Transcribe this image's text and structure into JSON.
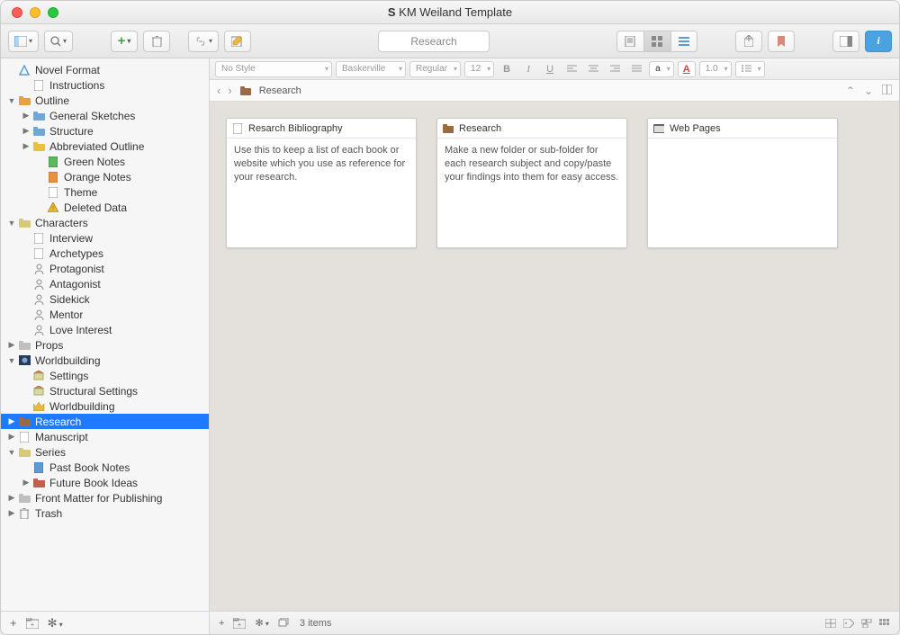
{
  "window": {
    "title": "KM Weiland Template"
  },
  "toolbar": {
    "search_value": "Research"
  },
  "format_bar": {
    "style": "No Style",
    "font": "Baskerville",
    "weight": "Regular",
    "size": "12",
    "text_scale": "1.0",
    "color_label": "a",
    "a_btn": "A"
  },
  "breadcrumb": {
    "location": "Research"
  },
  "sidebar": {
    "items": [
      {
        "label": "Novel Format",
        "depth": 0,
        "disc": "",
        "icon": "triangle-blue",
        "sel": false
      },
      {
        "label": "Instructions",
        "depth": 1,
        "disc": "",
        "icon": "doc",
        "sel": false
      },
      {
        "label": "Outline",
        "depth": 0,
        "disc": "▼",
        "icon": "folder-orange",
        "sel": false
      },
      {
        "label": "General Sketches",
        "depth": 1,
        "disc": "▶",
        "icon": "folder-blue",
        "sel": false
      },
      {
        "label": "Structure",
        "depth": 1,
        "disc": "▶",
        "icon": "folder-blue",
        "sel": false
      },
      {
        "label": "Abbreviated Outline",
        "depth": 1,
        "disc": "▶",
        "icon": "folder-yellow",
        "sel": false
      },
      {
        "label": "Green Notes",
        "depth": 2,
        "disc": "",
        "icon": "doc-green",
        "sel": false
      },
      {
        "label": "Orange Notes",
        "depth": 2,
        "disc": "",
        "icon": "doc-orange",
        "sel": false
      },
      {
        "label": "Theme",
        "depth": 2,
        "disc": "",
        "icon": "doc",
        "sel": false
      },
      {
        "label": "Deleted Data",
        "depth": 2,
        "disc": "",
        "icon": "warn",
        "sel": false
      },
      {
        "label": "Characters",
        "depth": 0,
        "disc": "▼",
        "icon": "folder-people",
        "sel": false
      },
      {
        "label": "Interview",
        "depth": 1,
        "disc": "",
        "icon": "doc",
        "sel": false
      },
      {
        "label": "Archetypes",
        "depth": 1,
        "disc": "",
        "icon": "doc",
        "sel": false
      },
      {
        "label": "Protagonist",
        "depth": 1,
        "disc": "",
        "icon": "person",
        "sel": false
      },
      {
        "label": "Antagonist",
        "depth": 1,
        "disc": "",
        "icon": "person",
        "sel": false
      },
      {
        "label": "Sidekick",
        "depth": 1,
        "disc": "",
        "icon": "person",
        "sel": false
      },
      {
        "label": "Mentor",
        "depth": 1,
        "disc": "",
        "icon": "person",
        "sel": false
      },
      {
        "label": "Love Interest",
        "depth": 1,
        "disc": "",
        "icon": "person",
        "sel": false
      },
      {
        "label": "Props",
        "depth": 0,
        "disc": "▶",
        "icon": "folder-gray",
        "sel": false
      },
      {
        "label": "Worldbuilding",
        "depth": 0,
        "disc": "▼",
        "icon": "folder-world",
        "sel": false
      },
      {
        "label": "Settings",
        "depth": 1,
        "disc": "",
        "icon": "setting",
        "sel": false
      },
      {
        "label": "Structural Settings",
        "depth": 1,
        "disc": "",
        "icon": "setting",
        "sel": false
      },
      {
        "label": "Worldbuilding",
        "depth": 1,
        "disc": "",
        "icon": "crown",
        "sel": false
      },
      {
        "label": "Research",
        "depth": 0,
        "disc": "▶",
        "icon": "folder-brown",
        "sel": true
      },
      {
        "label": "Manuscript",
        "depth": 0,
        "disc": "▶",
        "icon": "doc",
        "sel": false
      },
      {
        "label": "Series",
        "depth": 0,
        "disc": "▼",
        "icon": "folder-series",
        "sel": false
      },
      {
        "label": "Past Book Notes",
        "depth": 1,
        "disc": "",
        "icon": "doc-blue",
        "sel": false
      },
      {
        "label": "Future Book Ideas",
        "depth": 1,
        "disc": "▶",
        "icon": "folder-red",
        "sel": false
      },
      {
        "label": "Front Matter for Publishing",
        "depth": 0,
        "disc": "▶",
        "icon": "folder-gray",
        "sel": false
      },
      {
        "label": "Trash",
        "depth": 0,
        "disc": "▶",
        "icon": "trash",
        "sel": false
      }
    ]
  },
  "cards": [
    {
      "icon": "doc",
      "title": "Resarch Bibliography",
      "body": "Use this to keep a list of each book or website which you use as reference for your research."
    },
    {
      "icon": "folder-brown",
      "title": "Research",
      "body": "Make a new folder or sub-folder for each research subject and copy/paste your findings into them for easy access."
    },
    {
      "icon": "web",
      "title": "Web Pages",
      "body": ""
    }
  ],
  "footer": {
    "item_count": "3 items"
  },
  "colors": {
    "selection": "#1e7bff",
    "folder_orange": "#e8a23c",
    "folder_blue": "#6fa7d6",
    "folder_yellow": "#e8c23c",
    "folder_brown": "#9a6b3f",
    "folder_red": "#c65b4e",
    "doc_green": "#5cb85c",
    "doc_orange": "#e8923c",
    "doc_blue": "#5b9bd5",
    "warn": "#e8b93c"
  }
}
